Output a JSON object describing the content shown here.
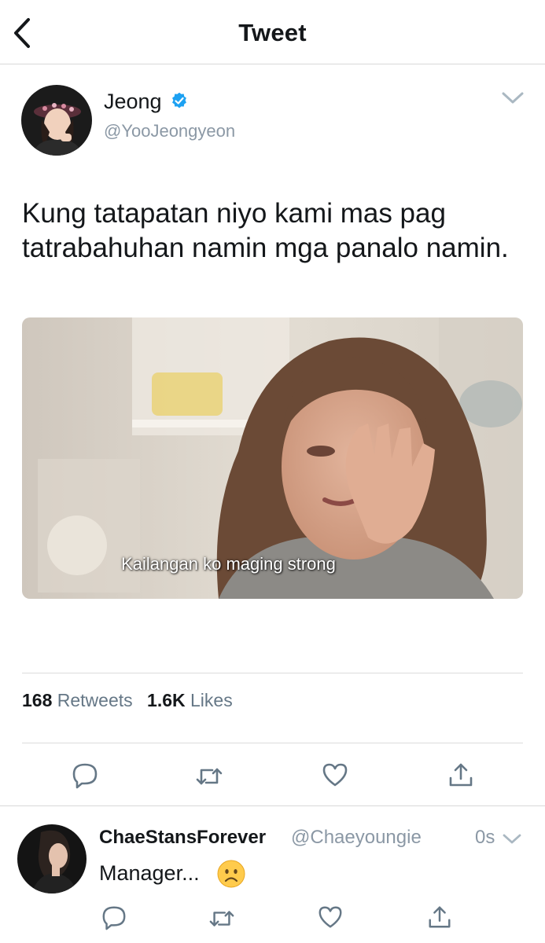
{
  "nav": {
    "title": "Tweet"
  },
  "tweet": {
    "author_name": "Jeong",
    "author_handle": "@YooJeongyeon",
    "text": "Kung tatapatan niyo kami mas pag tatrabahuhan namin mga panalo namin.",
    "media_caption": "Kailangan ko maging strong",
    "retweets_count": "168",
    "retweets_label": "Retweets",
    "likes_count": "1.6K",
    "likes_label": "Likes"
  },
  "reply": {
    "author_name": "ChaeStansForever",
    "author_handle": "@Chaeyoungie",
    "time": "0s",
    "text": "Manager..."
  },
  "colors": {
    "accent_blue": "#1da1f2",
    "icon_gray": "#657786",
    "text_dark": "#14171a",
    "text_muted": "#8b98a5"
  },
  "icons": [
    "back-icon",
    "verified-icon",
    "chevron-down-icon",
    "reply-icon",
    "retweet-icon",
    "like-icon",
    "share-icon",
    "frowning-face-emoji"
  ]
}
